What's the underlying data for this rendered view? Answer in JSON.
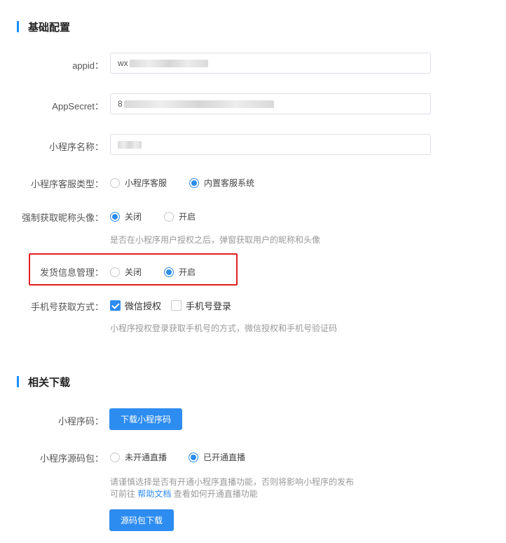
{
  "basic": {
    "title": "基础配置",
    "appid": {
      "label": "appid：",
      "prefix": "wx"
    },
    "appsecret": {
      "label": "AppSecret：",
      "prefix": "8"
    },
    "app_name": {
      "label": "小程序名称：",
      "prefix": ""
    },
    "service_type": {
      "label": "小程序客服类型：",
      "options": [
        "小程序客服",
        "内置客服系统"
      ],
      "selected": "内置客服系统"
    },
    "force_avatar": {
      "label": "强制获取昵称头像：",
      "options": [
        "关闭",
        "开启"
      ],
      "selected": "关闭",
      "hint": "是否在小程序用户授权之后，弹窗获取用户的昵称和头像"
    },
    "shipping_info": {
      "label": "发货信息管理：",
      "options": [
        "关闭",
        "开启"
      ],
      "selected": "开启"
    },
    "phone_method": {
      "label": "手机号获取方式：",
      "options": [
        "微信授权",
        "手机号登录"
      ],
      "checked": [
        "微信授权"
      ],
      "hint": "小程序授权登录获取手机号的方式，微信授权和手机号验证码"
    }
  },
  "downloads": {
    "title": "相关下载",
    "qrcode": {
      "label": "小程序码：",
      "button": "下载小程序码"
    },
    "source": {
      "label": "小程序源码包：",
      "options": [
        "未开通直播",
        "已开通直播"
      ],
      "selected": "已开通直播",
      "hint1": "请谨慎选择是否有开通小程序直播功能，否则将影响小程序的发布",
      "hint2_pre": "可前往",
      "hint2_link": "帮助文档",
      "hint2_post": "查看如何开通直播功能",
      "button": "源码包下载"
    }
  },
  "colors": {
    "accent": "#2d8cf0",
    "highlight": "#e02020"
  }
}
